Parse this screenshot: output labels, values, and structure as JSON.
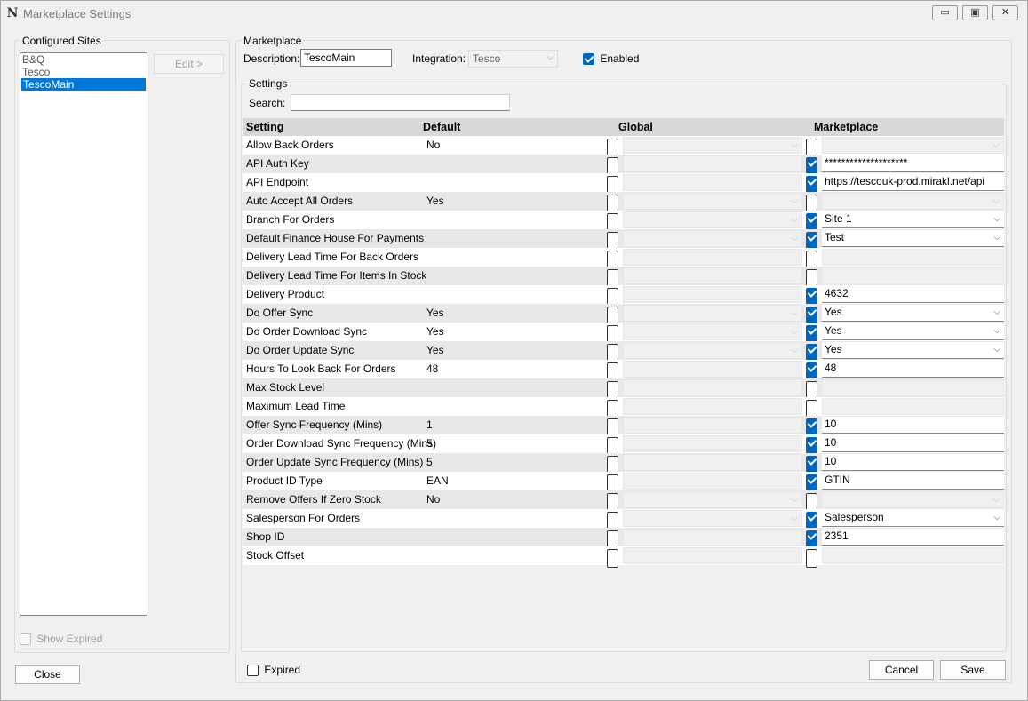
{
  "window": {
    "title": "Marketplace Settings",
    "minimize": "▭",
    "maximize": "▣",
    "close": "✕"
  },
  "sites": {
    "label": "Configured Sites",
    "items": [
      "B&Q",
      "Tesco",
      "TescoMain"
    ],
    "selected_index": 2,
    "edit_label": "Edit >",
    "show_expired_label": "Show Expired",
    "close_label": "Close"
  },
  "marketplace": {
    "label": "Marketplace",
    "description_label": "Description:",
    "description_value": "TescoMain",
    "integration_label": "Integration:",
    "integration_value": "Tesco",
    "enabled_label": "Enabled",
    "enabled": true
  },
  "settings": {
    "label": "Settings",
    "search_label": "Search:",
    "search_value": "",
    "columns": [
      "Setting",
      "Default",
      "Global",
      "Marketplace"
    ],
    "rows": [
      {
        "setting": "Allow Back Orders",
        "default": "No",
        "gtype": "combo",
        "mchecked": false,
        "mtype": "combo",
        "mvalue": ""
      },
      {
        "setting": "API Auth Key",
        "default": "",
        "gtype": "text",
        "mchecked": true,
        "mtype": "text",
        "mvalue": "********************"
      },
      {
        "setting": "API Endpoint",
        "default": "",
        "gtype": "text",
        "mchecked": true,
        "mtype": "text",
        "mvalue": "https://tescouk-prod.mirakl.net/api"
      },
      {
        "setting": "Auto Accept All Orders",
        "default": "Yes",
        "gtype": "combo",
        "mchecked": false,
        "mtype": "combo",
        "mvalue": ""
      },
      {
        "setting": "Branch For Orders",
        "default": "",
        "gtype": "combo",
        "mchecked": true,
        "mtype": "combo",
        "mvalue": "Site 1"
      },
      {
        "setting": "Default Finance House For Payments",
        "default": "",
        "gtype": "combo",
        "mchecked": true,
        "mtype": "combo",
        "mvalue": "Test"
      },
      {
        "setting": "Delivery Lead Time For Back Orders",
        "default": "",
        "gtype": "text",
        "mchecked": false,
        "mtype": "text",
        "mvalue": ""
      },
      {
        "setting": "Delivery Lead Time For Items In Stock",
        "default": "",
        "gtype": "text",
        "mchecked": false,
        "mtype": "text",
        "mvalue": ""
      },
      {
        "setting": "Delivery Product",
        "default": "",
        "gtype": "text",
        "mchecked": true,
        "mtype": "text",
        "mvalue": "4632"
      },
      {
        "setting": "Do Offer Sync",
        "default": "Yes",
        "gtype": "combo",
        "mchecked": true,
        "mtype": "combo",
        "mvalue": "Yes"
      },
      {
        "setting": "Do Order Download Sync",
        "default": "Yes",
        "gtype": "combo",
        "mchecked": true,
        "mtype": "combo",
        "mvalue": "Yes"
      },
      {
        "setting": "Do Order Update Sync",
        "default": "Yes",
        "gtype": "combo",
        "mchecked": true,
        "mtype": "combo",
        "mvalue": "Yes"
      },
      {
        "setting": "Hours To Look Back For Orders",
        "default": "48",
        "gtype": "text",
        "mchecked": true,
        "mtype": "text",
        "mvalue": "48"
      },
      {
        "setting": "Max Stock Level",
        "default": "",
        "gtype": "text",
        "mchecked": false,
        "mtype": "text",
        "mvalue": ""
      },
      {
        "setting": "Maximum Lead Time",
        "default": "",
        "gtype": "text",
        "mchecked": false,
        "mtype": "text",
        "mvalue": ""
      },
      {
        "setting": "Offer Sync Frequency (Mins)",
        "default": "1",
        "gtype": "text",
        "mchecked": true,
        "mtype": "text",
        "mvalue": "10"
      },
      {
        "setting": "Order Download Sync Frequency (Mins)",
        "default": "5",
        "gtype": "text",
        "mchecked": true,
        "mtype": "text",
        "mvalue": "10"
      },
      {
        "setting": "Order Update Sync Frequency (Mins)",
        "default": "5",
        "gtype": "text",
        "mchecked": true,
        "mtype": "text",
        "mvalue": "10"
      },
      {
        "setting": "Product ID Type",
        "default": "EAN",
        "gtype": "text",
        "mchecked": true,
        "mtype": "text",
        "mvalue": "GTIN"
      },
      {
        "setting": "Remove Offers If Zero Stock",
        "default": "No",
        "gtype": "combo",
        "mchecked": false,
        "mtype": "combo",
        "mvalue": ""
      },
      {
        "setting": "Salesperson For Orders",
        "default": "",
        "gtype": "combo",
        "mchecked": true,
        "mtype": "combo",
        "mvalue": "Salesperson"
      },
      {
        "setting": "Shop ID",
        "default": "",
        "gtype": "text",
        "mchecked": true,
        "mtype": "text",
        "mvalue": "2351"
      },
      {
        "setting": "Stock Offset",
        "default": "",
        "gtype": "text",
        "mchecked": false,
        "mtype": "text",
        "mvalue": ""
      }
    ]
  },
  "footer": {
    "expired_label": "Expired",
    "cancel_label": "Cancel",
    "save_label": "Save"
  },
  "colors": {
    "accent": "#0078d7",
    "checkbox": "#0067c0",
    "header": "#d8d8d8",
    "row_alt": "#e8e8e8"
  }
}
